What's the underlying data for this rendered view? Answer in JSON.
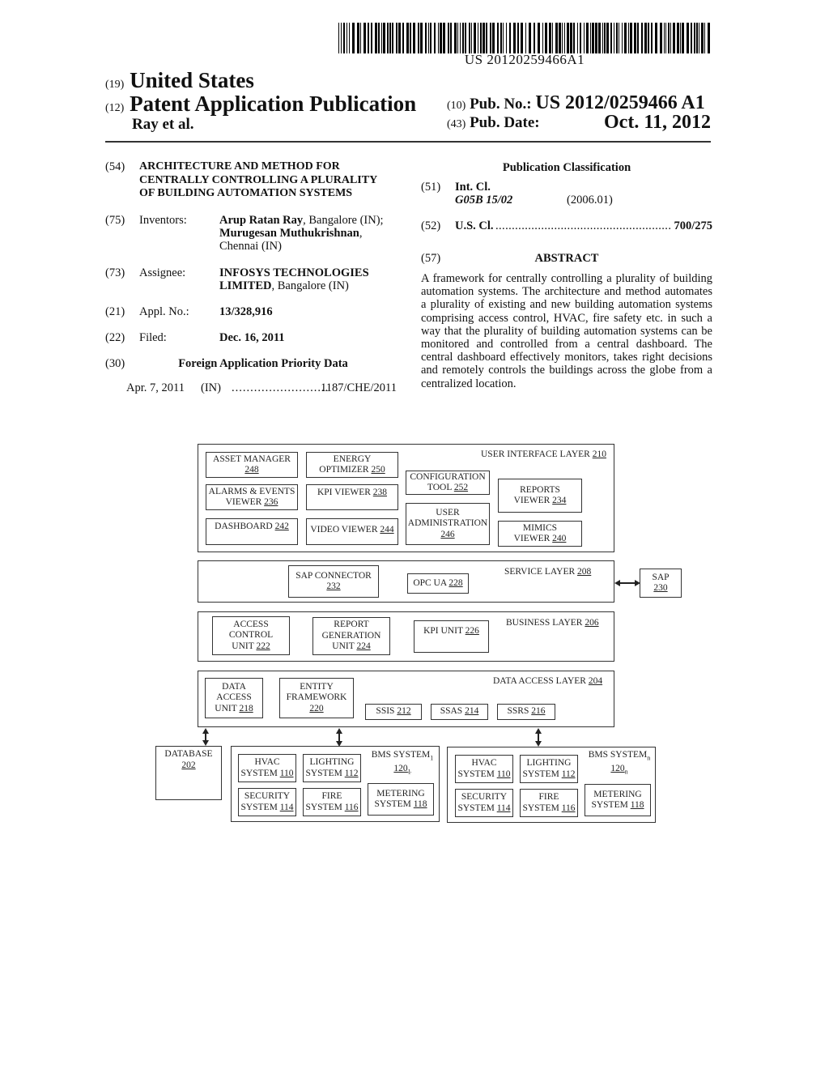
{
  "barcode": {
    "number": "US 20120259466A1"
  },
  "header": {
    "code_19": "(19)",
    "country": "United States",
    "code_12": "(12)",
    "doc_type": "Patent Application Publication",
    "authors": "Ray et al.",
    "code_10": "(10)",
    "pub_no_label": "Pub. No.:",
    "pub_no": "US 2012/0259466 A1",
    "code_43": "(43)",
    "pub_date_label": "Pub. Date:",
    "pub_date": "Oct. 11, 2012"
  },
  "bibliographic": {
    "title": {
      "code": "(54)",
      "lines": [
        "ARCHITECTURE AND METHOD FOR",
        "CENTRALLY CONTROLLING A PLURALITY",
        "OF BUILDING AUTOMATION SYSTEMS"
      ]
    },
    "inventors": {
      "code": "(75)",
      "label": "Inventors:",
      "name1": "Arup Ratan Ray",
      "loc1": ", Bangalore (IN);",
      "name2": "Murugesan Muthukrishnan",
      "loc2a": ",",
      "loc2b": "Chennai (IN)"
    },
    "assignee": {
      "code": "(73)",
      "label": "Assignee:",
      "name_line1": "INFOSYS TECHNOLOGIES",
      "name_line2": "LIMITED",
      "loc": ", Bangalore (IN)"
    },
    "appl_no": {
      "code": "(21)",
      "label": "Appl. No.:",
      "value": "13/328,916"
    },
    "filed": {
      "code": "(22)",
      "label": "Filed:",
      "value": "Dec. 16, 2011"
    },
    "foreign_priority": {
      "code": "(30)",
      "heading": "Foreign Application Priority Data",
      "date": "Apr. 7, 2011",
      "country": "(IN)",
      "dots": "..........................",
      "number": "1187/CHE/2011"
    }
  },
  "classification": {
    "heading": "Publication Classification",
    "int_cl": {
      "code": "(51)",
      "label": "Int. Cl.",
      "class": "G05B 15/02",
      "version": "(2006.01)"
    },
    "us_cl": {
      "code": "(52)",
      "label": "U.S. Cl.",
      "dots": "........................................................",
      "value": "700/275"
    }
  },
  "abstract": {
    "code": "(57)",
    "heading": "ABSTRACT",
    "text": "A framework for centrally controlling a plurality of building automation systems. The architecture and method automates a plurality of existing and new building automation systems comprising access control, HVAC, fire safety etc. in such a way that the plurality of building automation systems can be monitored and controlled from a central dashboard. The central dashboard effectively monitors, takes right decisions and remotely controls the buildings across the globe from a centralized location."
  },
  "diagram": {
    "ui_layer": {
      "label": "USER INTERFACE LAYER",
      "ref": "210",
      "asset_manager": {
        "l1": "ASSET MANAGER",
        "ref": "248"
      },
      "energy_optimizer": {
        "l1": "ENERGY",
        "l2": "OPTIMIZER",
        "ref": "250"
      },
      "alarms_events": {
        "l1": "ALARMS & EVENTS",
        "l2": "VIEWER",
        "ref": "236"
      },
      "kpi_viewer": {
        "l1": "KPI VIEWER",
        "ref": "238"
      },
      "dashboard": {
        "l1": "DASHBOARD",
        "ref": "242"
      },
      "video_viewer": {
        "l1": "VIDEO VIEWER",
        "ref": "244"
      },
      "config_tool": {
        "l1": "CONFIGURATION",
        "l2": "TOOL",
        "ref": "252"
      },
      "user_admin": {
        "l1": "USER",
        "l2": "ADMINISTRATION",
        "ref": "246"
      },
      "reports_viewer": {
        "l1": "REPORTS",
        "l2": "VIEWER",
        "ref": "234"
      },
      "mimics_viewer": {
        "l1": "MIMICS",
        "l2": "VIEWER",
        "ref": "240"
      }
    },
    "service_layer": {
      "label": "SERVICE LAYER",
      "ref": "208",
      "sap_connector": {
        "l1": "SAP CONNECTOR",
        "ref": "232"
      },
      "opc_ua": {
        "l1": "OPC UA",
        "ref": "228"
      }
    },
    "sap": {
      "l1": "SAP",
      "ref": "230"
    },
    "business_layer": {
      "label": "BUSINESS LAYER",
      "ref": "206",
      "access_control": {
        "l1": "ACCESS",
        "l2": "CONTROL",
        "l3": "UNIT",
        "ref": "222"
      },
      "report_gen": {
        "l1": "REPORT",
        "l2": "GENERATION",
        "l3": "UNIT",
        "ref": "224"
      },
      "kpi_unit": {
        "l1": "KPI UNIT",
        "ref": "226"
      }
    },
    "data_access_layer": {
      "label": "DATA ACCESS LAYER",
      "ref": "204",
      "data_access_unit": {
        "l1": "DATA",
        "l2": "ACCESS",
        "l3": "UNIT",
        "ref": "218"
      },
      "entity_framework": {
        "l1": "ENTITY",
        "l2": "FRAMEWORK",
        "ref": "220"
      },
      "ssis": {
        "l1": "SSIS",
        "ref": "212"
      },
      "ssas": {
        "l1": "SSAS",
        "ref": "214"
      },
      "ssrs": {
        "l1": "SSRS",
        "ref": "216"
      }
    },
    "database": {
      "l1": "DATABASE",
      "ref": "202"
    },
    "bms1": {
      "label": "BMS SYSTEM",
      "label_sub": "1",
      "ref": "120",
      "ref_sub": "1"
    },
    "bmsn": {
      "label": "BMS SYSTEM",
      "label_sub": "n",
      "ref": "120",
      "ref_sub": "n"
    },
    "subsystems": {
      "hvac": {
        "l1": "HVAC",
        "l2": "SYSTEM",
        "ref": "110"
      },
      "lighting": {
        "l1": "LIGHTING",
        "l2": "SYSTEM",
        "ref": "112"
      },
      "security": {
        "l1": "SECURITY",
        "l2": "SYSTEM",
        "ref": "114"
      },
      "fire": {
        "l1": "FIRE",
        "l2": "SYSTEM",
        "ref": "116"
      },
      "metering": {
        "l1": "METERING",
        "l2": "SYSTEM",
        "ref": "118"
      }
    }
  }
}
